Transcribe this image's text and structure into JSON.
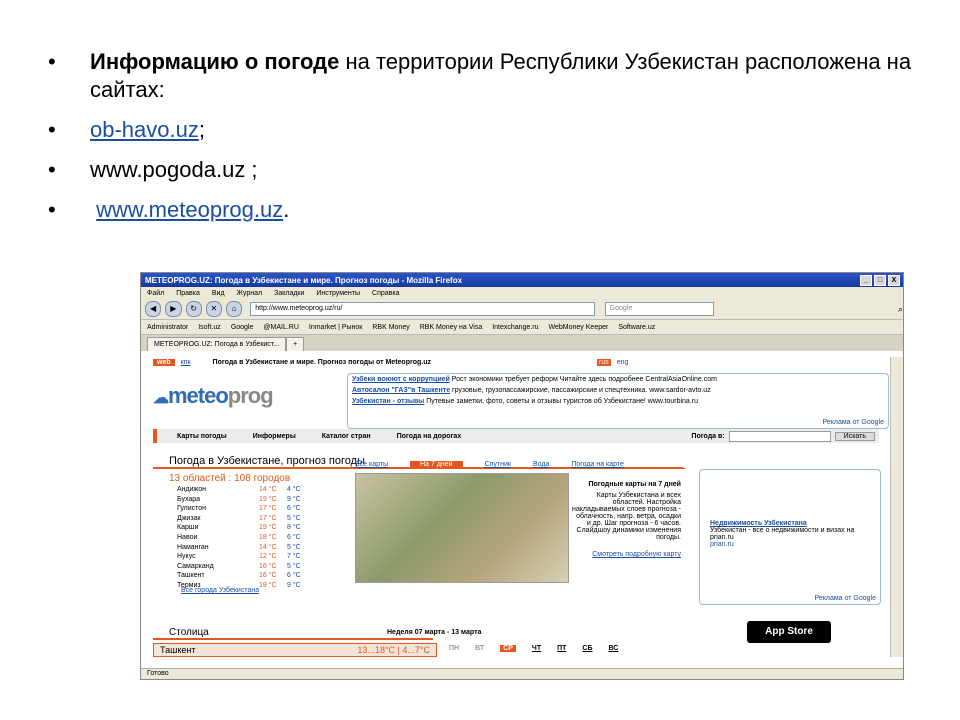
{
  "bullets": {
    "b1_bold": "Информацию о погоде",
    "b1_rest": " на территории Республики Узбекистан расположена на сайтах:",
    "b2_link": "ob-havo.uz",
    "b2_tail": ";",
    "b3_text": "www.pogoda.uz ;",
    "b4_link": "www.meteoprog.uz",
    "b4_tail": "."
  },
  "browser": {
    "title": "METEOPROG.UZ: Погода в Узбекистане и мире. Прогноз погоды - Mozilla Firefox",
    "controls": [
      "_",
      "□",
      "X"
    ],
    "menu": [
      "Файл",
      "Правка",
      "Вид",
      "Журнал",
      "Закладки",
      "Инструменты",
      "Справка"
    ],
    "url": "http://www.meteoprog.uz/ru/",
    "search_placeholder": "Google",
    "bookmarks": [
      "Administrator",
      "Isoft.uz",
      "Google",
      "@MAIL.RU",
      "Inmarket | Рынок",
      "RBK Money",
      "RBK Money на Visa",
      "Intexchange.ru",
      "WebMoney Keeper",
      "Software.uz"
    ],
    "tab": "METEOPROG.UZ: Погода в Узбекист...",
    "status": "Готово"
  },
  "site": {
    "web": "web",
    "knk": "кпк",
    "tagline": "Погода в Узбекистане и мире. Прогноз погоды от Meteoprog.uz",
    "rus": "rus",
    "eng": "eng",
    "logo_a": "meteo",
    "logo_b": "prog",
    "ads": [
      {
        "link": "Узбеки воюют с коррупцией",
        "text": " Рост экономики требует реформ Читайте здесь подробнее CentralAsiaOnline.com"
      },
      {
        "link": "Автосалон \"ГАЗ\"в Ташкенте",
        "text": " грузовые, грузопассажирские, пассажирские и спецтехника. www.sardor-avto.uz"
      },
      {
        "link": "Узбекистан - отзывы",
        "text": " Путевые заметки, фото, советы и отзывы туристов об Узбекистане! www.tourbina.ru"
      }
    ],
    "google_ads": "Реклама от Google",
    "menu": [
      "Карты погоды",
      "Информеры",
      "Каталог стран",
      "Погода на дорогах"
    ],
    "weather_in": "Погода в:",
    "search_btn": "Искать",
    "heading": "Погода в Узбекистане, прогноз погоды",
    "subheading": "13 областей : 108 городов",
    "cities": [
      {
        "name": "Андижон",
        "t1": "14 °C",
        "t2": "4 °C"
      },
      {
        "name": "Бухара",
        "t1": "19 °C",
        "t2": "9 °C"
      },
      {
        "name": "Гулистон",
        "t1": "17 °C",
        "t2": "6 °C"
      },
      {
        "name": "Джизак",
        "t1": "17 °C",
        "t2": "5 °C"
      },
      {
        "name": "Карши",
        "t1": "19 °C",
        "t2": "8 °C"
      },
      {
        "name": "Навои",
        "t1": "18 °C",
        "t2": "6 °C"
      },
      {
        "name": "Наманган",
        "t1": "14 °C",
        "t2": "5 °C"
      },
      {
        "name": "Нукус",
        "t1": "12 °C",
        "t2": "7 °C"
      },
      {
        "name": "Самарканд",
        "t1": "16 °C",
        "t2": "5 °C"
      },
      {
        "name": "Ташкент",
        "t1": "16 °C",
        "t2": "6 °C"
      },
      {
        "name": "Термиз",
        "t1": "19 °C",
        "t2": "9 °C"
      }
    ],
    "all_cities": "Все города Узбекистана",
    "map_tabs": [
      "Все карты",
      "На 7 дней",
      "Спутник",
      "Вода",
      "Погода на карте"
    ],
    "map_title": "Погодные карты на 7 дней",
    "map_text": "Карты Узбекистана и всех областей. Настройка накладываемых слоев прогноза - облачность, напр. ветра, осадки и др. Шаг прогноза - 6 часов. Слайдшоу динамики изменения погоды.",
    "map_link": "Смотреть подробную карту",
    "right_ad_link": "Недвижимость Узбекистана",
    "right_ad_text": "Узбекистан - все о недвижимости и визах на prian.ru",
    "right_ad_url": "prian.ru",
    "appstore": "App Store",
    "capital": "Столица",
    "week": "Неделя 07 марта - 13 марта",
    "tashkent": "Ташкент",
    "tashkent_vals": "13...18°C | 4...7°C",
    "days": [
      "ПН",
      "ВТ",
      "СР",
      "ЧТ",
      "ПТ",
      "СБ",
      "ВС"
    ]
  }
}
